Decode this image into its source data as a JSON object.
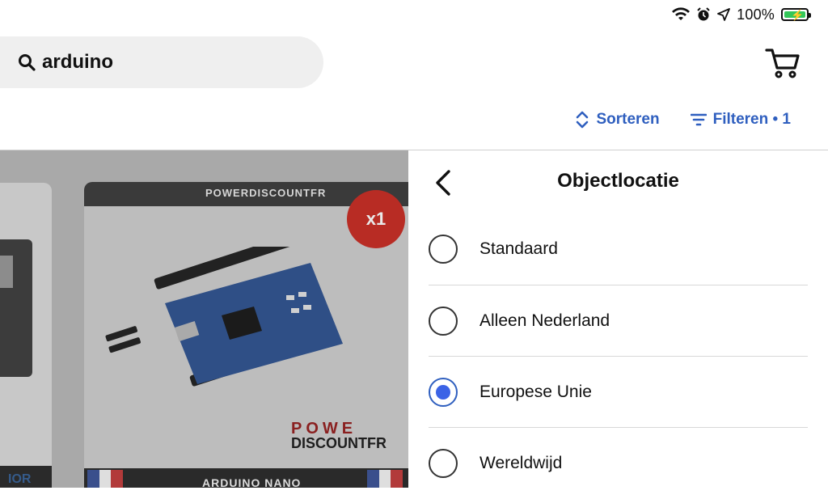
{
  "status_bar": {
    "battery_pct": "100%",
    "battery_level": 1.0,
    "icons": [
      "wifi-icon",
      "alarm-icon",
      "location-arrow-icon",
      "battery-charging-icon"
    ]
  },
  "search": {
    "query": "arduino",
    "icon": "search-icon"
  },
  "header": {
    "cart_icon": "cart-icon"
  },
  "toolbar": {
    "sort_label": "Sorteren",
    "filter_label": "Filteren • 1",
    "accent": "#2f5fbf"
  },
  "products": {
    "brand_top": "POWERDISCOUNTFR",
    "badge": "x1",
    "logo_line1": "POWE",
    "logo_line2": "DISCOUNTFR",
    "bottom_text": "ARDUINO NANO",
    "left_card_text": "IOR"
  },
  "panel": {
    "title": "Objectlocatie",
    "options": [
      {
        "label": "Standaard",
        "selected": false
      },
      {
        "label": "Alleen Nederland",
        "selected": false
      },
      {
        "label": "Europese Unie",
        "selected": true
      },
      {
        "label": "Wereldwijd",
        "selected": false
      }
    ],
    "selected_color": "#3b63e6"
  }
}
